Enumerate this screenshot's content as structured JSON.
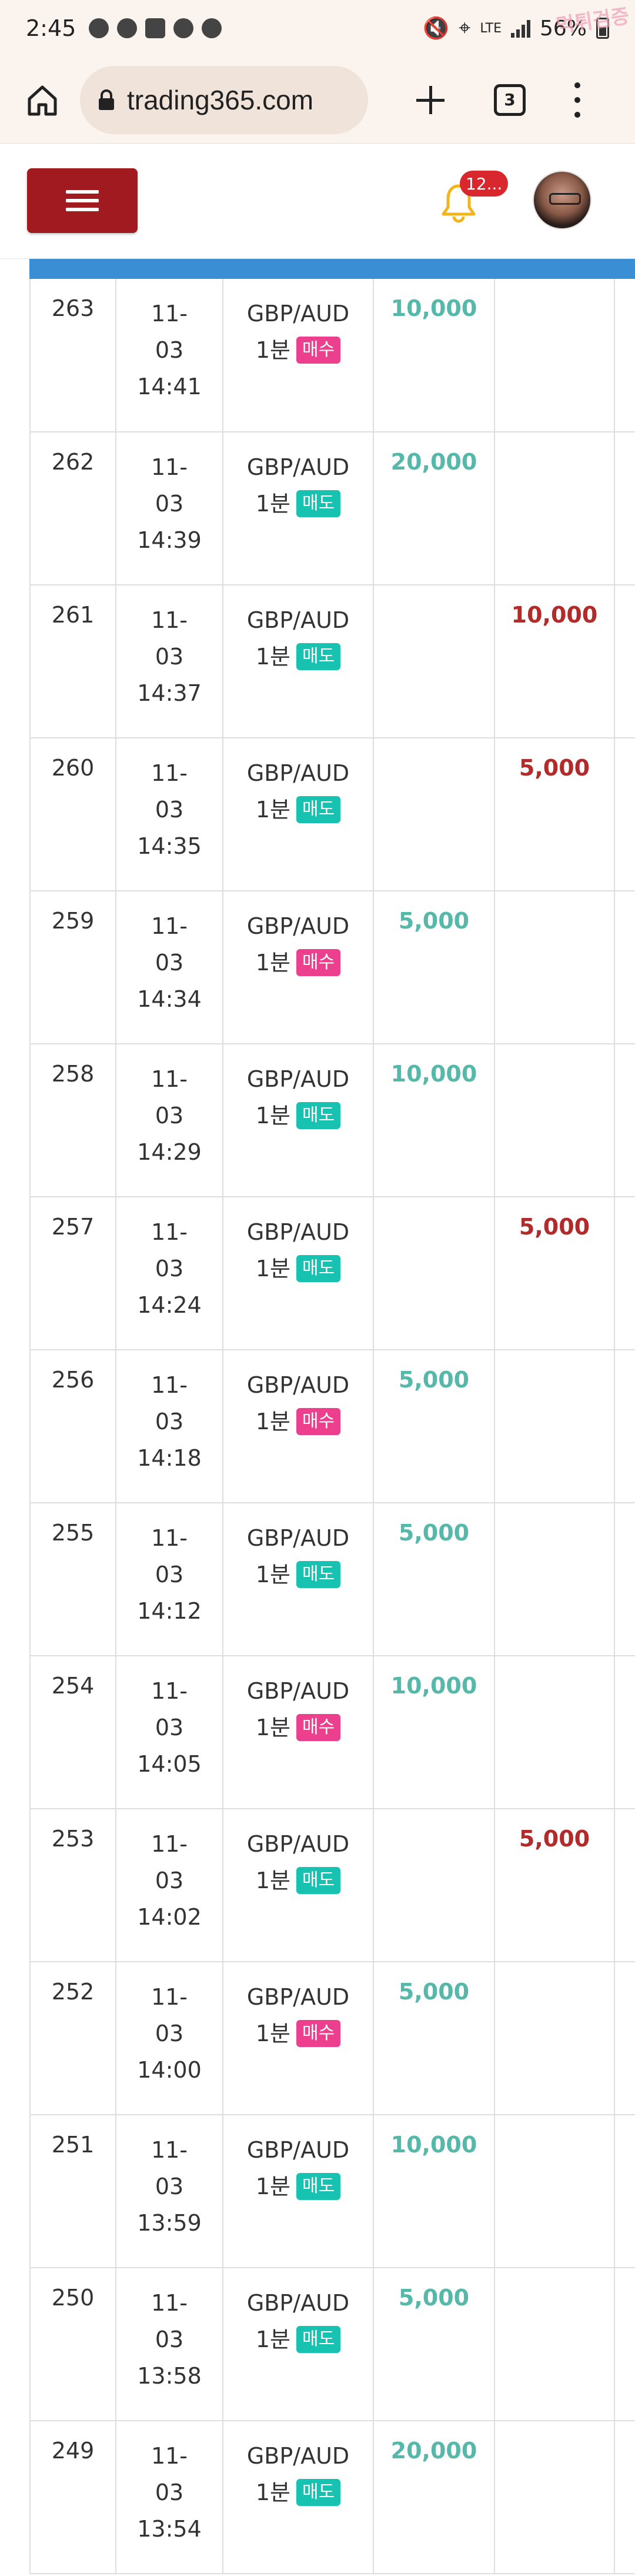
{
  "status_bar": {
    "time": "2:45",
    "network": "LTE",
    "battery": "56%",
    "watermark": "먹튀검증"
  },
  "browser": {
    "url": "trading365.com",
    "tab_count": "3"
  },
  "header": {
    "notification_count": "12..."
  },
  "table": {
    "rows": [
      {
        "no": "263",
        "date": "11-",
        "day": "03",
        "time": "14:41",
        "symbol": "GBP/AUD",
        "period": "1분",
        "side": "매수",
        "side_type": "buy",
        "up": "10,000",
        "down": ""
      },
      {
        "no": "262",
        "date": "11-",
        "day": "03",
        "time": "14:39",
        "symbol": "GBP/AUD",
        "period": "1분",
        "side": "매도",
        "side_type": "sell",
        "up": "20,000",
        "down": ""
      },
      {
        "no": "261",
        "date": "11-",
        "day": "03",
        "time": "14:37",
        "symbol": "GBP/AUD",
        "period": "1분",
        "side": "매도",
        "side_type": "sell",
        "up": "",
        "down": "10,000"
      },
      {
        "no": "260",
        "date": "11-",
        "day": "03",
        "time": "14:35",
        "symbol": "GBP/AUD",
        "period": "1분",
        "side": "매도",
        "side_type": "sell",
        "up": "",
        "down": "5,000"
      },
      {
        "no": "259",
        "date": "11-",
        "day": "03",
        "time": "14:34",
        "symbol": "GBP/AUD",
        "period": "1분",
        "side": "매수",
        "side_type": "buy",
        "up": "5,000",
        "down": ""
      },
      {
        "no": "258",
        "date": "11-",
        "day": "03",
        "time": "14:29",
        "symbol": "GBP/AUD",
        "period": "1분",
        "side": "매도",
        "side_type": "sell",
        "up": "10,000",
        "down": ""
      },
      {
        "no": "257",
        "date": "11-",
        "day": "03",
        "time": "14:24",
        "symbol": "GBP/AUD",
        "period": "1분",
        "side": "매도",
        "side_type": "sell",
        "up": "",
        "down": "5,000"
      },
      {
        "no": "256",
        "date": "11-",
        "day": "03",
        "time": "14:18",
        "symbol": "GBP/AUD",
        "period": "1분",
        "side": "매수",
        "side_type": "buy",
        "up": "5,000",
        "down": ""
      },
      {
        "no": "255",
        "date": "11-",
        "day": "03",
        "time": "14:12",
        "symbol": "GBP/AUD",
        "period": "1분",
        "side": "매도",
        "side_type": "sell",
        "up": "5,000",
        "down": ""
      },
      {
        "no": "254",
        "date": "11-",
        "day": "03",
        "time": "14:05",
        "symbol": "GBP/AUD",
        "period": "1분",
        "side": "매수",
        "side_type": "buy",
        "up": "10,000",
        "down": ""
      },
      {
        "no": "253",
        "date": "11-",
        "day": "03",
        "time": "14:02",
        "symbol": "GBP/AUD",
        "period": "1분",
        "side": "매도",
        "side_type": "sell",
        "up": "",
        "down": "5,000"
      },
      {
        "no": "252",
        "date": "11-",
        "day": "03",
        "time": "14:00",
        "symbol": "GBP/AUD",
        "period": "1분",
        "side": "매수",
        "side_type": "buy",
        "up": "5,000",
        "down": ""
      },
      {
        "no": "251",
        "date": "11-",
        "day": "03",
        "time": "13:59",
        "symbol": "GBP/AUD",
        "period": "1분",
        "side": "매도",
        "side_type": "sell",
        "up": "10,000",
        "down": ""
      },
      {
        "no": "250",
        "date": "11-",
        "day": "03",
        "time": "13:58",
        "symbol": "GBP/AUD",
        "period": "1분",
        "side": "매도",
        "side_type": "sell",
        "up": "5,000",
        "down": ""
      },
      {
        "no": "249",
        "date": "11-",
        "day": "03",
        "time": "13:54",
        "symbol": "GBP/AUD",
        "period": "1분",
        "side": "매도",
        "side_type": "sell",
        "up": "20,000",
        "down": ""
      }
    ]
  }
}
